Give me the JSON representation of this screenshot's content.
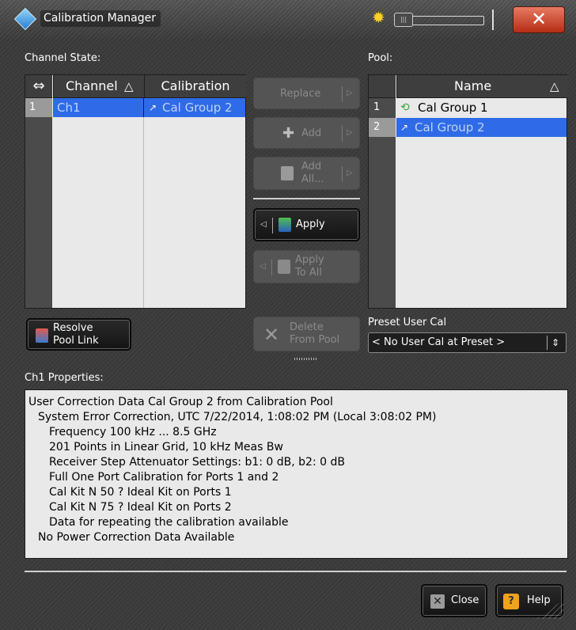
{
  "window": {
    "title": "Calibration Manager"
  },
  "channel_state": {
    "label": "Channel State:",
    "swap_symbol": "⇔",
    "headers": {
      "channel": "Channel",
      "channel_sort": "△",
      "calibration": "Calibration"
    },
    "rows": [
      {
        "index": "1",
        "channel": "Ch1",
        "calibration": "Cal Group 2"
      }
    ]
  },
  "buttons": {
    "replace": "Replace",
    "add": "Add",
    "add_all_line1": "Add",
    "add_all_line2": "All...",
    "apply": "Apply",
    "apply_to_all_line1": "Apply",
    "apply_to_all_line2": "To All",
    "resolve_line1": "Resolve",
    "resolve_line2": "Pool Link",
    "delete_line1": "Delete",
    "delete_line2": "From Pool",
    "close": "Close",
    "help": "Help"
  },
  "pool": {
    "label": "Pool:",
    "headers": {
      "name": "Name",
      "sort": "△"
    },
    "rows": [
      {
        "index": "1",
        "name": "Cal Group 1"
      },
      {
        "index": "2",
        "name": "Cal Group 2"
      }
    ]
  },
  "preset": {
    "label": "Preset User Cal",
    "value": "< No User Cal at Preset >"
  },
  "properties": {
    "label": "Ch1 Properties:",
    "lines": [
      "User Correction Data Cal Group 2 from Calibration Pool",
      "System Error Correction, UTC 7/22/2014, 1:08:02 PM (Local 3:08:02 PM)",
      "Frequency 100 kHz ... 8.5 GHz",
      "201 Points in Linear Grid, 10 kHz Meas Bw",
      "Receiver Step Attenuator Settings: b1: 0 dB, b2: 0 dB",
      "Full One Port Calibration for Ports 1 and 2",
      "Cal Kit N 50 ? Ideal Kit on Ports 1",
      "Cal Kit N 75 ? Ideal Kit on Ports 2",
      "Data for repeating the calibration available",
      "No Power Correction Data Available"
    ]
  },
  "colors": {
    "selection": "#2f6be8",
    "panel": "#e9e9e9",
    "close_red": "#c9452a"
  },
  "icons": [
    "app-icon",
    "sun-icon",
    "close-window-icon",
    "linked-cal-icon",
    "cal-group-icon",
    "add-icon",
    "add-all-icon",
    "apply-icon",
    "apply-to-all-icon",
    "resolve-icon",
    "delete-icon",
    "close-icon",
    "help-icon",
    "dropdown-icon"
  ]
}
